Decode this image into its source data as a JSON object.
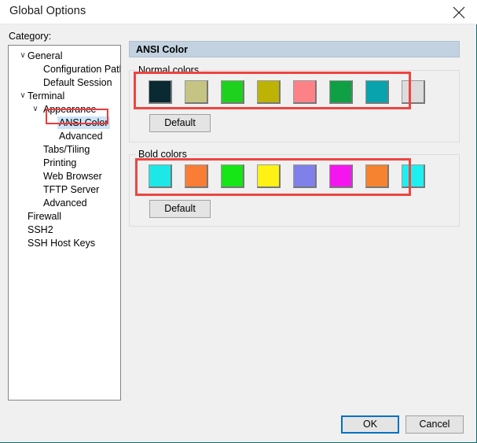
{
  "window": {
    "title": "Global Options",
    "close_icon": "close-icon"
  },
  "category": {
    "label": "Category:",
    "tree": [
      {
        "label": "General",
        "depth": 0,
        "chevron": "∨",
        "selected": false
      },
      {
        "label": "Configuration Paths",
        "depth": 1,
        "chevron": "",
        "selected": false
      },
      {
        "label": "Default Session",
        "depth": 1,
        "chevron": "",
        "selected": false
      },
      {
        "label": "Terminal",
        "depth": 0,
        "chevron": "∨",
        "selected": false
      },
      {
        "label": "Appearance",
        "depth": 1,
        "chevron": "∨",
        "selected": false
      },
      {
        "label": "ANSI Color",
        "depth": 2,
        "chevron": "",
        "selected": true
      },
      {
        "label": "Advanced",
        "depth": 2,
        "chevron": "",
        "selected": false
      },
      {
        "label": "Tabs/Tiling",
        "depth": 1,
        "chevron": "",
        "selected": false
      },
      {
        "label": "Printing",
        "depth": 1,
        "chevron": "",
        "selected": false
      },
      {
        "label": "Web Browser",
        "depth": 1,
        "chevron": "",
        "selected": false
      },
      {
        "label": "TFTP Server",
        "depth": 1,
        "chevron": "",
        "selected": false
      },
      {
        "label": "Advanced",
        "depth": 1,
        "chevron": "",
        "selected": false
      },
      {
        "label": "Firewall",
        "depth": 0,
        "chevron": "",
        "selected": false
      },
      {
        "label": "SSH2",
        "depth": 0,
        "chevron": "",
        "selected": false
      },
      {
        "label": "SSH Host Keys",
        "depth": 0,
        "chevron": "",
        "selected": false
      }
    ]
  },
  "content": {
    "header_title": "ANSI Color",
    "normal_group": {
      "legend": "Normal colors",
      "default_button": "Default",
      "swatches": [
        {
          "name": "normal-color-0",
          "hex": "#0a2a33"
        },
        {
          "name": "normal-color-1",
          "hex": "#c5c483"
        },
        {
          "name": "normal-color-2",
          "hex": "#1fd11f"
        },
        {
          "name": "normal-color-3",
          "hex": "#bdb305"
        },
        {
          "name": "normal-color-4",
          "hex": "#fd8287"
        },
        {
          "name": "normal-color-5",
          "hex": "#0fa045"
        },
        {
          "name": "normal-color-6",
          "hex": "#08a3ad"
        },
        {
          "name": "normal-color-7",
          "hex": "#dcdcdc"
        }
      ]
    },
    "bold_group": {
      "legend": "Bold colors",
      "default_button": "Default",
      "swatches": [
        {
          "name": "bold-color-0",
          "hex": "#1ce8e8"
        },
        {
          "name": "bold-color-1",
          "hex": "#fa7d36"
        },
        {
          "name": "bold-color-2",
          "hex": "#16e516"
        },
        {
          "name": "bold-color-3",
          "hex": "#fdf213"
        },
        {
          "name": "bold-color-4",
          "hex": "#7f80ea"
        },
        {
          "name": "bold-color-5",
          "hex": "#f516ef"
        },
        {
          "name": "bold-color-6",
          "hex": "#f5832f"
        },
        {
          "name": "bold-color-7",
          "hex": "#1ef0f0"
        }
      ]
    }
  },
  "footer": {
    "ok_label": "OK",
    "cancel_label": "Cancel"
  },
  "annotations": {
    "accent_color": "#ee4540",
    "selection_color": "#cce4f7",
    "focus_color": "#0072c6"
  }
}
